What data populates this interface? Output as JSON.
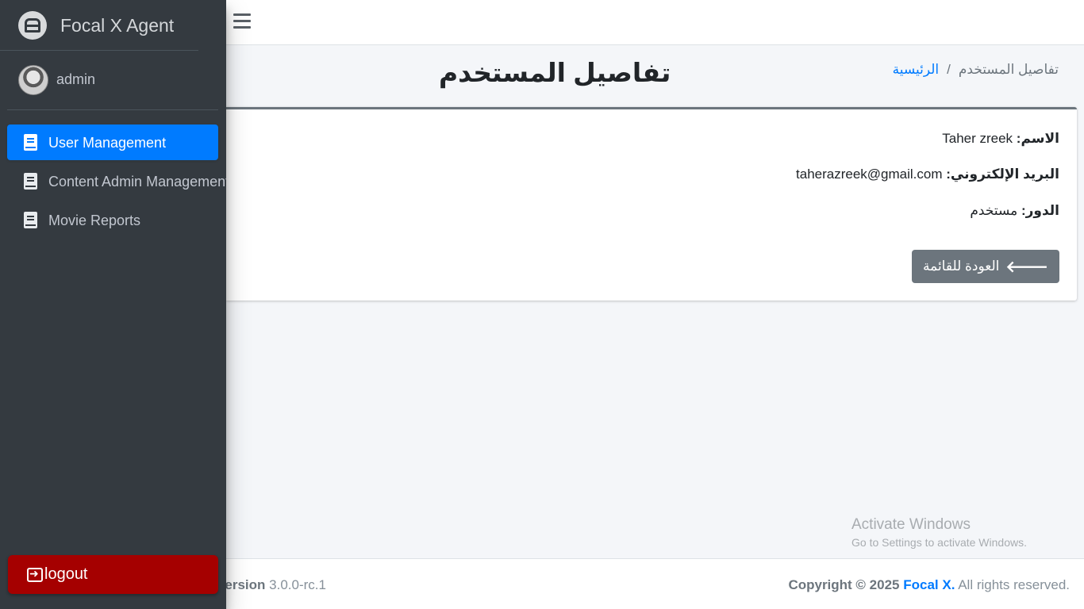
{
  "sidebar": {
    "brand": "Focal X Agent",
    "user": "admin",
    "items": [
      {
        "label": "User Management",
        "active": true
      },
      {
        "label": "Content Admin Management",
        "active": false
      },
      {
        "label": "Movie Reports",
        "active": false
      }
    ],
    "logout_label": "logout"
  },
  "header": {
    "title": "تفاصيل المستخدم",
    "breadcrumb": {
      "home": "الرئيسية",
      "separator": "/",
      "current": "تفاصيل المستخدم"
    }
  },
  "details": {
    "name_label": "الاسم:",
    "name_value": "Taher zreek",
    "email_label": "البريد الإلكتروني:",
    "email_value": "taherazreek@gmail.com",
    "role_label": "الدور:",
    "role_value": "مستخدم",
    "back_button": "العودة للقائمة"
  },
  "footer": {
    "version_label": "Version",
    "version_value": "3.0.0-rc.1",
    "copyright_prefix": "Copyright © 2025",
    "copyright_brand": "Focal X.",
    "copyright_suffix": "All rights reserved."
  },
  "watermark": {
    "title": "Activate Windows",
    "subtitle": "Go to Settings to activate Windows."
  },
  "colors": {
    "sidebar_bg": "#343a40",
    "primary": "#007bff",
    "secondary": "#6c757d",
    "logout": "#a50000"
  },
  "icons": [
    "hamburger-icon",
    "brand-logo-icon",
    "book-icon",
    "arrow-left-icon",
    "logout-icon"
  ]
}
